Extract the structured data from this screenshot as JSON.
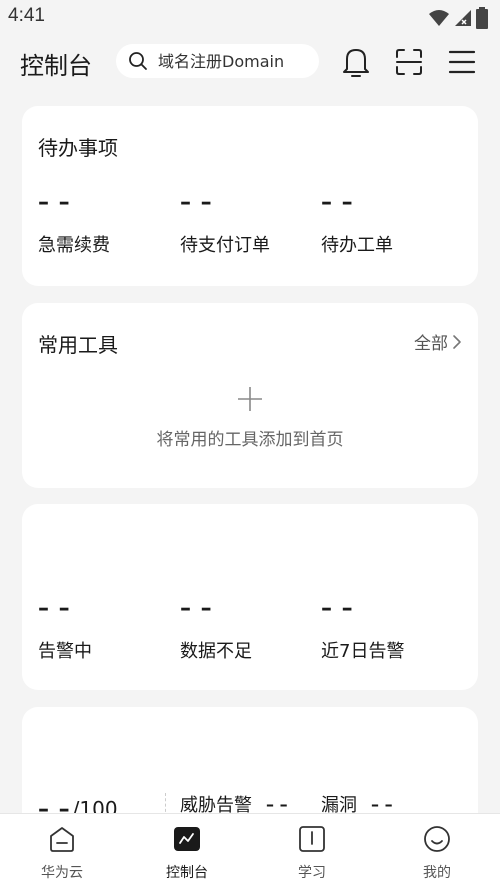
{
  "status_bar": {
    "time": "4:41"
  },
  "header": {
    "title": "控制台",
    "search_placeholder": "域名注册Domain"
  },
  "todo_card": {
    "title": "待办事项",
    "stats": [
      {
        "value": "– –",
        "label": "急需续费"
      },
      {
        "value": "– –",
        "label": "待支付订单"
      },
      {
        "value": "– –",
        "label": "待办工单"
      }
    ]
  },
  "tools_card": {
    "title": "常用工具",
    "all_label": "全部",
    "add_label": "将常用的工具添加到首页"
  },
  "alerts_card": {
    "stats": [
      {
        "value": "– –",
        "label": "告警中"
      },
      {
        "value": "– –",
        "label": "数据不足"
      },
      {
        "value": "– –",
        "label": "近7日告警"
      }
    ]
  },
  "security_card": {
    "score_value": "– –",
    "score_total": "/100",
    "threat_label": "威胁告警",
    "threat_value": "– –",
    "vuln_label": "漏洞",
    "vuln_value": "– –"
  },
  "bottom_nav": {
    "items": [
      {
        "label": "华为云",
        "icon": "home-icon"
      },
      {
        "label": "控制台",
        "icon": "console-icon",
        "active": true
      },
      {
        "label": "学习",
        "icon": "book-icon"
      },
      {
        "label": "我的",
        "icon": "smile-icon"
      }
    ]
  },
  "colors": {
    "background": "#f4f4f4",
    "card": "#ffffff",
    "text": "#1a1a1a",
    "muted": "#666666"
  }
}
